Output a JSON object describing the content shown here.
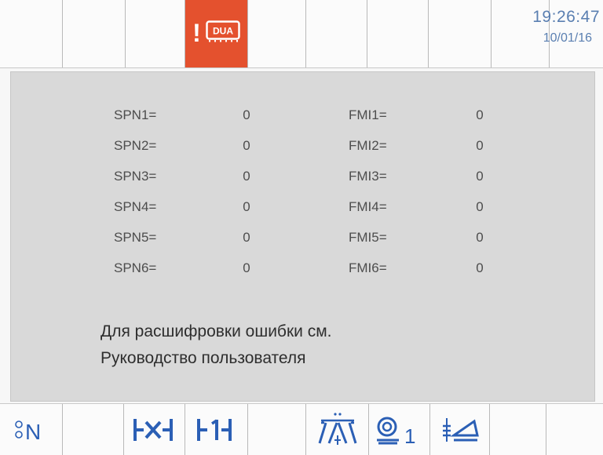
{
  "header": {
    "alarm_icon": "alarm-dpf-icon",
    "alarm_text": "DUA",
    "time": "19:26:47",
    "date": "10/01/16",
    "colors": {
      "alarm_bg": "#e4512e",
      "clock": "#5a7fb1",
      "softkeys": "#2b5fb5"
    }
  },
  "fault_codes": {
    "spn": [
      {
        "label": "SPN1=",
        "value": "0"
      },
      {
        "label": "SPN2=",
        "value": "0"
      },
      {
        "label": "SPN3=",
        "value": "0"
      },
      {
        "label": "SPN4=",
        "value": "0"
      },
      {
        "label": "SPN5=",
        "value": "0"
      },
      {
        "label": "SPN6=",
        "value": "0"
      }
    ],
    "fmi": [
      {
        "label": "FMI1=",
        "value": "0"
      },
      {
        "label": "FMI2=",
        "value": "0"
      },
      {
        "label": "FMI3=",
        "value": "0"
      },
      {
        "label": "FMI4=",
        "value": "0"
      },
      {
        "label": "FMI5=",
        "value": "0"
      },
      {
        "label": "FMI6=",
        "value": "0"
      }
    ]
  },
  "note": {
    "line1": "Для расшифровки ошибки см.",
    "line2": "Руководство пользователя"
  },
  "softkeys": {
    "neutral_label": "N",
    "header_1_label": "1",
    "icons": [
      "neutral-gear-icon",
      "axle-lock-icon",
      "axle-unlock-icon",
      "boom-float-icon",
      "header-1-icon",
      "header-tilt-icon"
    ]
  }
}
